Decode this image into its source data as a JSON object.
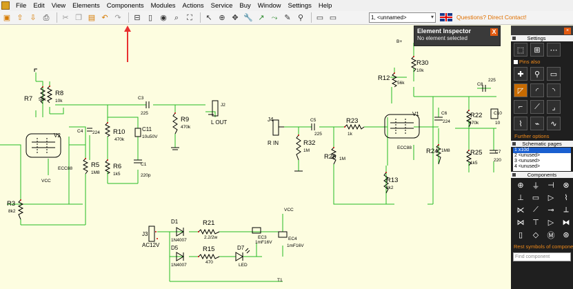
{
  "menu": {
    "items": [
      "File",
      "Edit",
      "View",
      "Elements",
      "Components",
      "Modules",
      "Actions",
      "Service",
      "Buy",
      "Window",
      "Settings",
      "Help"
    ]
  },
  "toolbar": {
    "tab_select_value": "1, <unnamed>",
    "contact_link": "Questions? Direct Contact!"
  },
  "inspector": {
    "title": "Element Inspector",
    "status": "No element selected",
    "close_label": "X"
  },
  "right_panel": {
    "settings_header": "Settings",
    "pins_also": "Pins also",
    "further_options": "Further options",
    "pages_header": "Schematic pages",
    "pages": [
      "1 x10d",
      "2 <unused>",
      "3 <unused>",
      "4 <unused>"
    ],
    "components_header": "Components",
    "rest_symbols": "Rest symbols of componen",
    "find_placeholder": "Find component"
  },
  "schematic": {
    "labels": {
      "r7": "R7",
      "r7v": "56k",
      "r8": "R8",
      "r8v": "10k",
      "c3": "C3",
      "c3v": "225",
      "c4": "C4",
      "c4v": "224",
      "r10": "R10",
      "r10v": "470k",
      "c11": "C11",
      "c11v": "10u50V",
      "r9": "R9",
      "r9v": "470k",
      "j2": "J2",
      "lout": "L OUT",
      "v2": "V2",
      "ecc88a": "ECC88",
      "r5": "R5",
      "r5v": "1M8",
      "r6": "R6",
      "r6v": "1k5",
      "c1": "C1",
      "c1v": "220p",
      "r3": "R3",
      "r3v": "8k2",
      "vcc1": "VCC",
      "j4": "J4",
      "rin": "R IN",
      "c5": "C5",
      "c5v": "225",
      "r23": "R23",
      "r23v": "1k",
      "r32": "R32",
      "r32v": "1M",
      "r26": "R26",
      "r26v": "1M",
      "r12": "R12",
      "r12v": "56k",
      "r30": "R30",
      "r30v": "10k",
      "v1": "V1",
      "ecc88b": "ECC88",
      "c6": "C6",
      "c6v": "224",
      "r24": "R24",
      "r24v": "1M8",
      "r13": "R13",
      "r13v": "8k2",
      "c8": "C8",
      "c8v": "225",
      "r22": "R22",
      "r22v": "470k",
      "c10": "C10",
      "c10v": "10",
      "r25": "R25",
      "r25v": "1k5",
      "c7": "C7",
      "c7v": "220",
      "bplus": "B+",
      "j3": "J3",
      "ac12v": "AC12V",
      "d1": "D1",
      "d1v": "1N4007",
      "r21": "R21",
      "r21v": "2.2/2w",
      "ec3": "EC3",
      "ec3v": "1mF16V",
      "ec4": "EC4",
      "ec4v": "1mF16V",
      "vcc2": "VCC",
      "d5": "D5",
      "d5v": "1N4007",
      "r15": "R15",
      "r15v": "470",
      "d7": "D7",
      "led": "LED",
      "t1": "T1"
    }
  },
  "colors": {
    "canvas_bg": "#fdfde0",
    "wire": "#22bb22",
    "component": "#000000",
    "pin": "#cc0000",
    "accent": "#e35a10",
    "panel_bg": "#1f1f1f",
    "arrow": "#e83030"
  }
}
